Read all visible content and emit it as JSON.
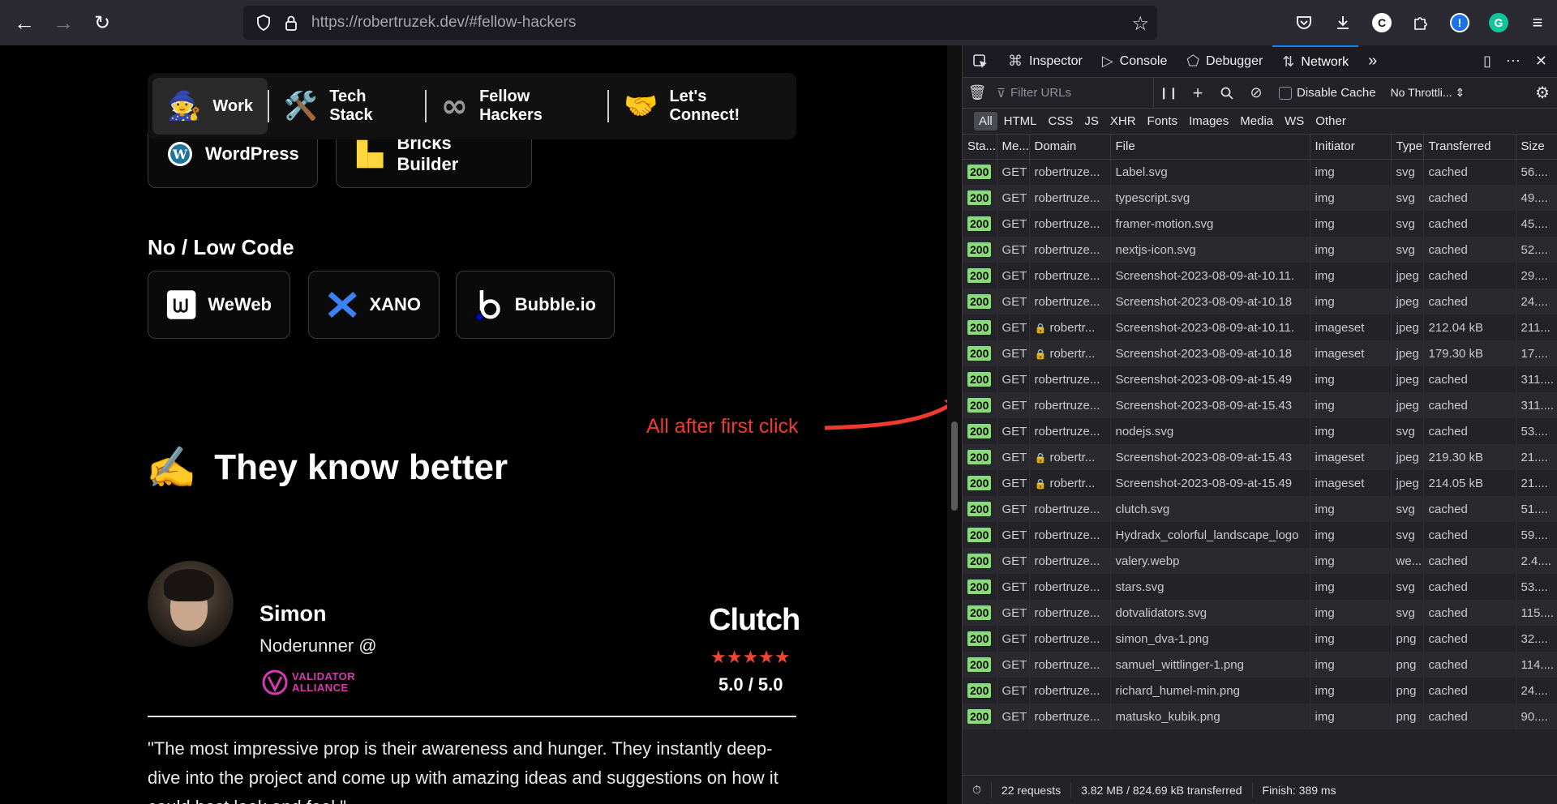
{
  "browser": {
    "url_host": "https://robertruzek.dev",
    "url_path": "/#fellow-hackers"
  },
  "page": {
    "nav": [
      {
        "emoji": "🧙",
        "label": "Work"
      },
      {
        "emoji": "🛠️",
        "label": "Tech Stack"
      },
      {
        "emoji": "∞",
        "label": "Fellow Hackers"
      },
      {
        "emoji": "🤝",
        "label": "Let's Connect!"
      }
    ],
    "cms_chips": [
      {
        "label": "WordPress"
      },
      {
        "label": "Bricks Builder"
      }
    ],
    "nocode_heading": "No / Low Code",
    "nocode_chips": [
      {
        "label": "WeWeb"
      },
      {
        "label": "XANO"
      },
      {
        "label": "Bubble.io"
      }
    ],
    "annotation": "All after first click",
    "section_emoji": "✍️",
    "section_title": "They know better",
    "testimonial": {
      "name": "Simon",
      "role": "Noderunner @",
      "company_logo_line1": "VALIDATOR",
      "company_logo_line2": "ALLIANCE",
      "platform": "Clutch",
      "stars": "★★★★★",
      "rating": "5.0 / 5.0",
      "quote": "\"The most impressive prop is their awareness and hunger. They instantly deep-dive into the project and come up with amazing ideas and suggestions on how it could best look and feel.\""
    }
  },
  "devtools": {
    "tabs": [
      "Inspector",
      "Console",
      "Debugger",
      "Network"
    ],
    "filter_placeholder": "Filter URLs",
    "disable_cache": "Disable Cache",
    "throttling": "No Throttli...",
    "type_filters": [
      "All",
      "HTML",
      "CSS",
      "JS",
      "XHR",
      "Fonts",
      "Images",
      "Media",
      "WS",
      "Other"
    ],
    "columns": [
      "Sta...",
      "Me...",
      "Domain",
      "File",
      "Initiator",
      "Type",
      "Transferred",
      "Size"
    ],
    "requests": [
      {
        "status": "200",
        "method": "GET",
        "domain": "robertruze...",
        "locked": false,
        "file": "Label.svg",
        "initiator": "img",
        "type": "svg",
        "transferred": "cached",
        "size": "56...."
      },
      {
        "status": "200",
        "method": "GET",
        "domain": "robertruze...",
        "locked": false,
        "file": "typescript.svg",
        "initiator": "img",
        "type": "svg",
        "transferred": "cached",
        "size": "49...."
      },
      {
        "status": "200",
        "method": "GET",
        "domain": "robertruze...",
        "locked": false,
        "file": "framer-motion.svg",
        "initiator": "img",
        "type": "svg",
        "transferred": "cached",
        "size": "45...."
      },
      {
        "status": "200",
        "method": "GET",
        "domain": "robertruze...",
        "locked": false,
        "file": "nextjs-icon.svg",
        "initiator": "img",
        "type": "svg",
        "transferred": "cached",
        "size": "52...."
      },
      {
        "status": "200",
        "method": "GET",
        "domain": "robertruze...",
        "locked": false,
        "file": "Screenshot-2023-08-09-at-10.11.",
        "initiator": "img",
        "type": "jpeg",
        "transferred": "cached",
        "size": "29...."
      },
      {
        "status": "200",
        "method": "GET",
        "domain": "robertruze...",
        "locked": false,
        "file": "Screenshot-2023-08-09-at-10.18",
        "initiator": "img",
        "type": "jpeg",
        "transferred": "cached",
        "size": "24...."
      },
      {
        "status": "200",
        "method": "GET",
        "domain": "robertr...",
        "locked": true,
        "file": "Screenshot-2023-08-09-at-10.11.",
        "initiator": "imageset",
        "type": "jpeg",
        "transferred": "212.04 kB",
        "size": "211..."
      },
      {
        "status": "200",
        "method": "GET",
        "domain": "robertr...",
        "locked": true,
        "file": "Screenshot-2023-08-09-at-10.18",
        "initiator": "imageset",
        "type": "jpeg",
        "transferred": "179.30 kB",
        "size": "17...."
      },
      {
        "status": "200",
        "method": "GET",
        "domain": "robertruze...",
        "locked": false,
        "file": "Screenshot-2023-08-09-at-15.49",
        "initiator": "img",
        "type": "jpeg",
        "transferred": "cached",
        "size": "311...."
      },
      {
        "status": "200",
        "method": "GET",
        "domain": "robertruze...",
        "locked": false,
        "file": "Screenshot-2023-08-09-at-15.43",
        "initiator": "img",
        "type": "jpeg",
        "transferred": "cached",
        "size": "311...."
      },
      {
        "status": "200",
        "method": "GET",
        "domain": "robertruze...",
        "locked": false,
        "file": "nodejs.svg",
        "initiator": "img",
        "type": "svg",
        "transferred": "cached",
        "size": "53...."
      },
      {
        "status": "200",
        "method": "GET",
        "domain": "robertr...",
        "locked": true,
        "file": "Screenshot-2023-08-09-at-15.43",
        "initiator": "imageset",
        "type": "jpeg",
        "transferred": "219.30 kB",
        "size": "21...."
      },
      {
        "status": "200",
        "method": "GET",
        "domain": "robertr...",
        "locked": true,
        "file": "Screenshot-2023-08-09-at-15.49",
        "initiator": "imageset",
        "type": "jpeg",
        "transferred": "214.05 kB",
        "size": "21...."
      },
      {
        "status": "200",
        "method": "GET",
        "domain": "robertruze...",
        "locked": false,
        "file": "clutch.svg",
        "initiator": "img",
        "type": "svg",
        "transferred": "cached",
        "size": "51...."
      },
      {
        "status": "200",
        "method": "GET",
        "domain": "robertruze...",
        "locked": false,
        "file": "Hydradx_colorful_landscape_logo",
        "initiator": "img",
        "type": "svg",
        "transferred": "cached",
        "size": "59...."
      },
      {
        "status": "200",
        "method": "GET",
        "domain": "robertruze...",
        "locked": false,
        "file": "valery.webp",
        "initiator": "img",
        "type": "we...",
        "transferred": "cached",
        "size": "2.4...."
      },
      {
        "status": "200",
        "method": "GET",
        "domain": "robertruze...",
        "locked": false,
        "file": "stars.svg",
        "initiator": "img",
        "type": "svg",
        "transferred": "cached",
        "size": "53...."
      },
      {
        "status": "200",
        "method": "GET",
        "domain": "robertruze...",
        "locked": false,
        "file": "dotvalidators.svg",
        "initiator": "img",
        "type": "svg",
        "transferred": "cached",
        "size": "115...."
      },
      {
        "status": "200",
        "method": "GET",
        "domain": "robertruze...",
        "locked": false,
        "file": "simon_dva-1.png",
        "initiator": "img",
        "type": "png",
        "transferred": "cached",
        "size": "32...."
      },
      {
        "status": "200",
        "method": "GET",
        "domain": "robertruze...",
        "locked": false,
        "file": "samuel_wittlinger-1.png",
        "initiator": "img",
        "type": "png",
        "transferred": "cached",
        "size": "114...."
      },
      {
        "status": "200",
        "method": "GET",
        "domain": "robertruze...",
        "locked": false,
        "file": "richard_humel-min.png",
        "initiator": "img",
        "type": "png",
        "transferred": "cached",
        "size": "24...."
      },
      {
        "status": "200",
        "method": "GET",
        "domain": "robertruze...",
        "locked": false,
        "file": "matusko_kubik.png",
        "initiator": "img",
        "type": "png",
        "transferred": "cached",
        "size": "90...."
      }
    ],
    "status_bar": {
      "requests": "22 requests",
      "transferred": "3.82 MB / 824.69 kB transferred",
      "finish": "Finish: 389 ms"
    }
  }
}
